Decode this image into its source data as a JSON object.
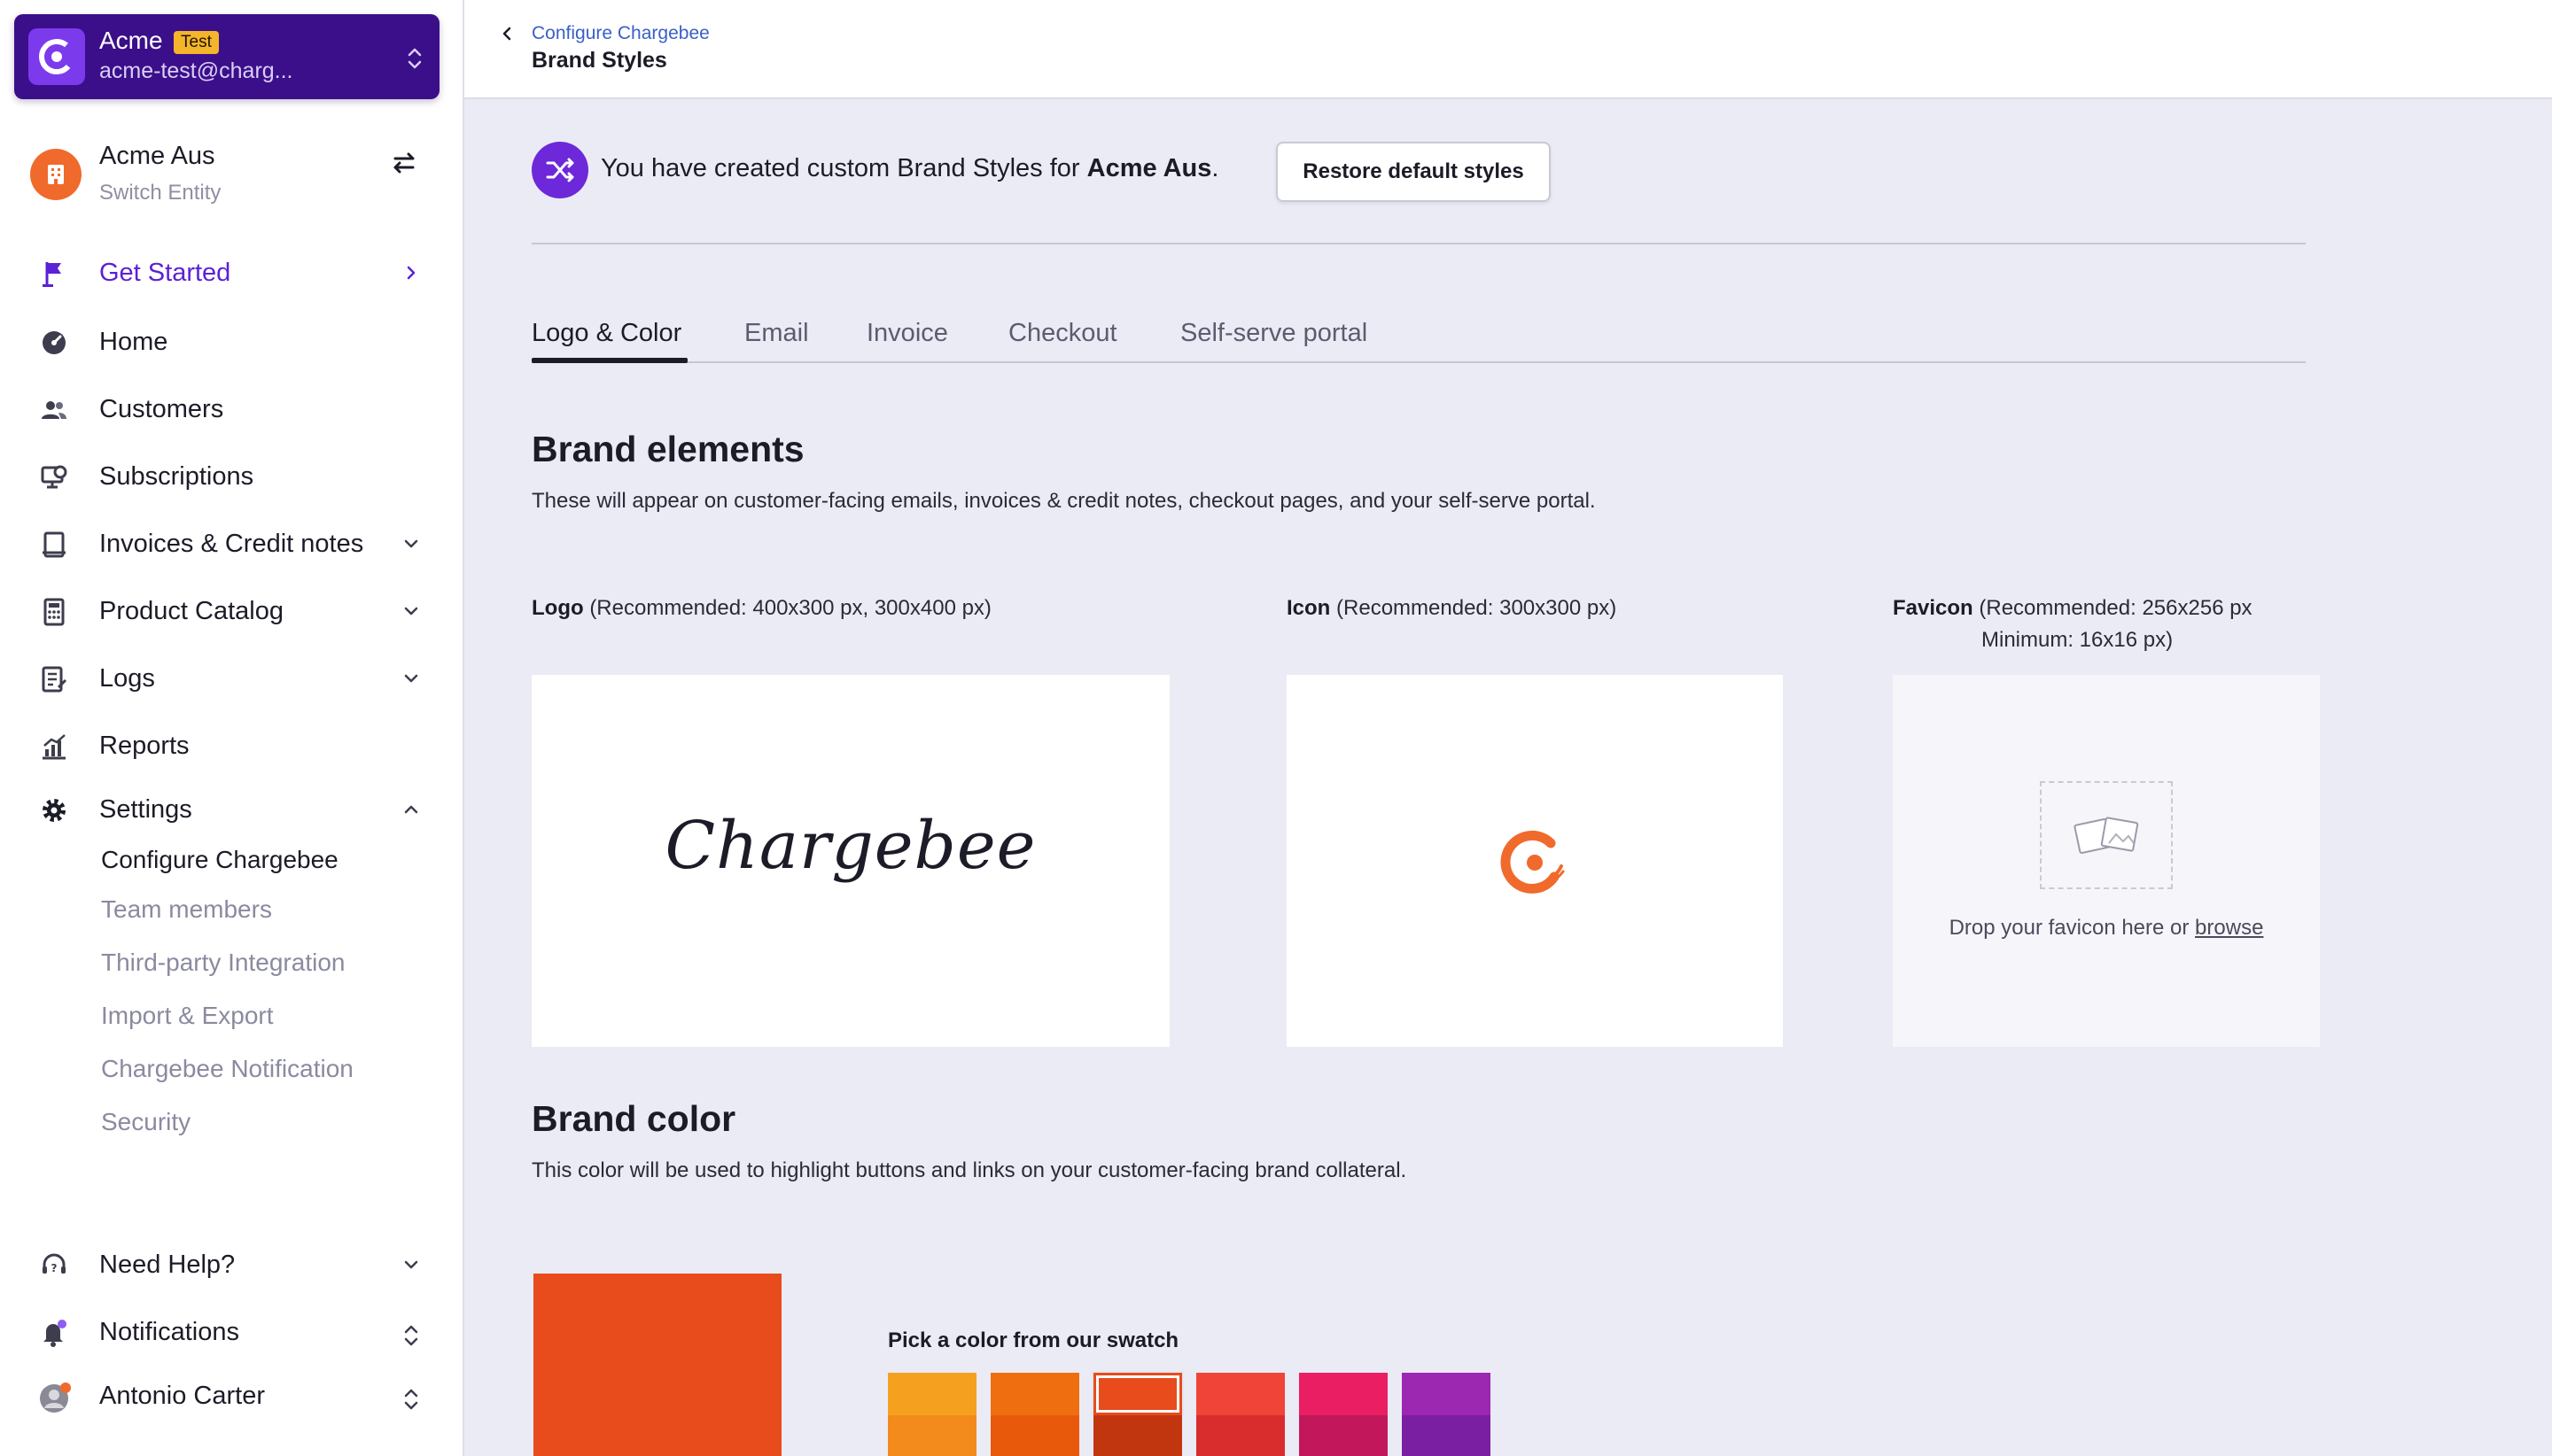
{
  "account": {
    "name": "Acme",
    "badge": "Test",
    "email": "acme-test@charg..."
  },
  "entity": {
    "name": "Acme Aus",
    "subtitle": "Switch Entity"
  },
  "nav": {
    "get_started": "Get Started",
    "home": "Home",
    "customers": "Customers",
    "subscriptions": "Subscriptions",
    "invoices": "Invoices & Credit notes",
    "product_catalog": "Product Catalog",
    "logs": "Logs",
    "reports": "Reports",
    "settings": "Settings",
    "settings_items": [
      "Configure Chargebee",
      "Team members",
      "Third-party Integration",
      "Import & Export",
      "Chargebee Notification",
      "Security"
    ],
    "need_help": "Need Help?",
    "notifications": "Notifications",
    "user": "Antonio Carter"
  },
  "header": {
    "breadcrumb": "Configure Chargebee",
    "title": "Brand Styles"
  },
  "notice": {
    "text_prefix": "You have created custom Brand Styles for ",
    "entity": "Acme Aus",
    "text_suffix": ".",
    "restore_button": "Restore default styles"
  },
  "tabs": [
    "Logo & Color",
    "Email",
    "Invoice",
    "Checkout",
    "Self-serve portal"
  ],
  "brand_elements": {
    "title": "Brand elements",
    "description": "These will appear on customer-facing emails, invoices & credit notes, checkout pages, and your self-serve portal.",
    "logo_label": "Logo",
    "logo_hint": "(Recommended: 400x300 px, 300x400 px)",
    "logo_wordmark": "Chargebee",
    "icon_label": "Icon",
    "icon_hint": "(Recommended: 300x300 px)",
    "favicon_label": "Favicon",
    "favicon_hint_line1": "(Recommended: 256x256 px",
    "favicon_hint_line2": "Minimum: 16x16 px)",
    "favicon_drop_text": "Drop your favicon here or ",
    "favicon_browse": "browse"
  },
  "brand_color": {
    "title": "Brand color",
    "description": "This color will be used to highlight buttons and links on your customer-facing brand collateral.",
    "selected_color": "#e84b1c",
    "swatch_label": "Pick a color from our swatch",
    "swatches": [
      {
        "top": "#f5a11f",
        "bottom": "#f38a1c"
      },
      {
        "top": "#ef6e0f",
        "bottom": "#e8590c"
      },
      {
        "top": "#e84b1c",
        "bottom": "#c2360f"
      },
      {
        "top": "#f04438",
        "bottom": "#d92d2d"
      },
      {
        "top": "#e91e63",
        "bottom": "#c2185b"
      },
      {
        "top": "#9c27b0",
        "bottom": "#7b1fa2"
      }
    ]
  },
  "colors": {
    "accent_purple": "#5b21d6",
    "account_bg": "#3b0f8a",
    "entity_orange": "#f06a2c",
    "link_blue": "#3a5fc7"
  }
}
